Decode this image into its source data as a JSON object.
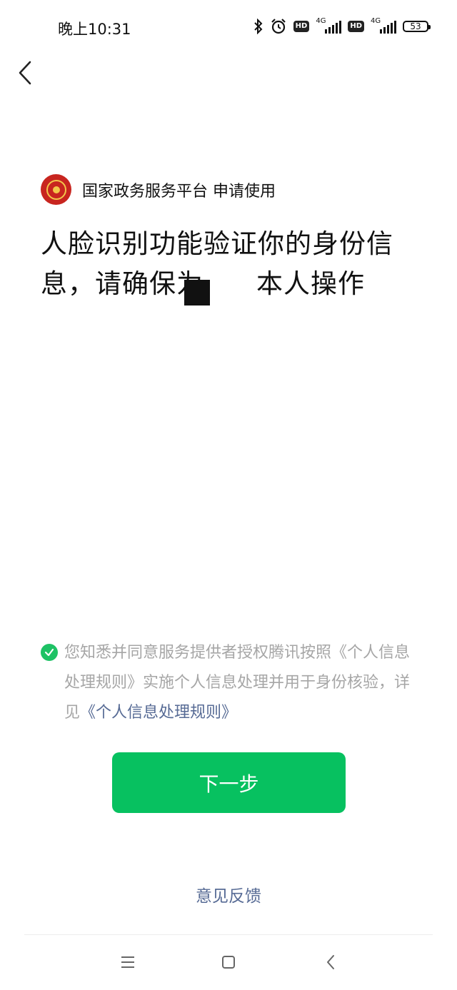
{
  "status_bar": {
    "time": "晚上10:31",
    "hd_label": "HD",
    "network": "4G",
    "battery": "53"
  },
  "requester": {
    "name": "国家政务服务平台 申请使用"
  },
  "headline": {
    "line1": "人脸识别功能验证你的身份信",
    "line2_part1": "息，请确保为",
    "line2_part2": "本人操作"
  },
  "consent": {
    "text": "您知悉并同意服务提供者授权腾讯按照《个人信息处理规则》实施个人信息处理并用于身份核验，详见",
    "link": "《个人信息处理规则》"
  },
  "next_button": {
    "label": "下一步"
  },
  "feedback": {
    "label": "意见反馈"
  },
  "colors": {
    "primary_green": "#07c160",
    "check_green": "#1ec265",
    "link_blue": "#576b95",
    "muted_text": "#a6a6a6"
  }
}
